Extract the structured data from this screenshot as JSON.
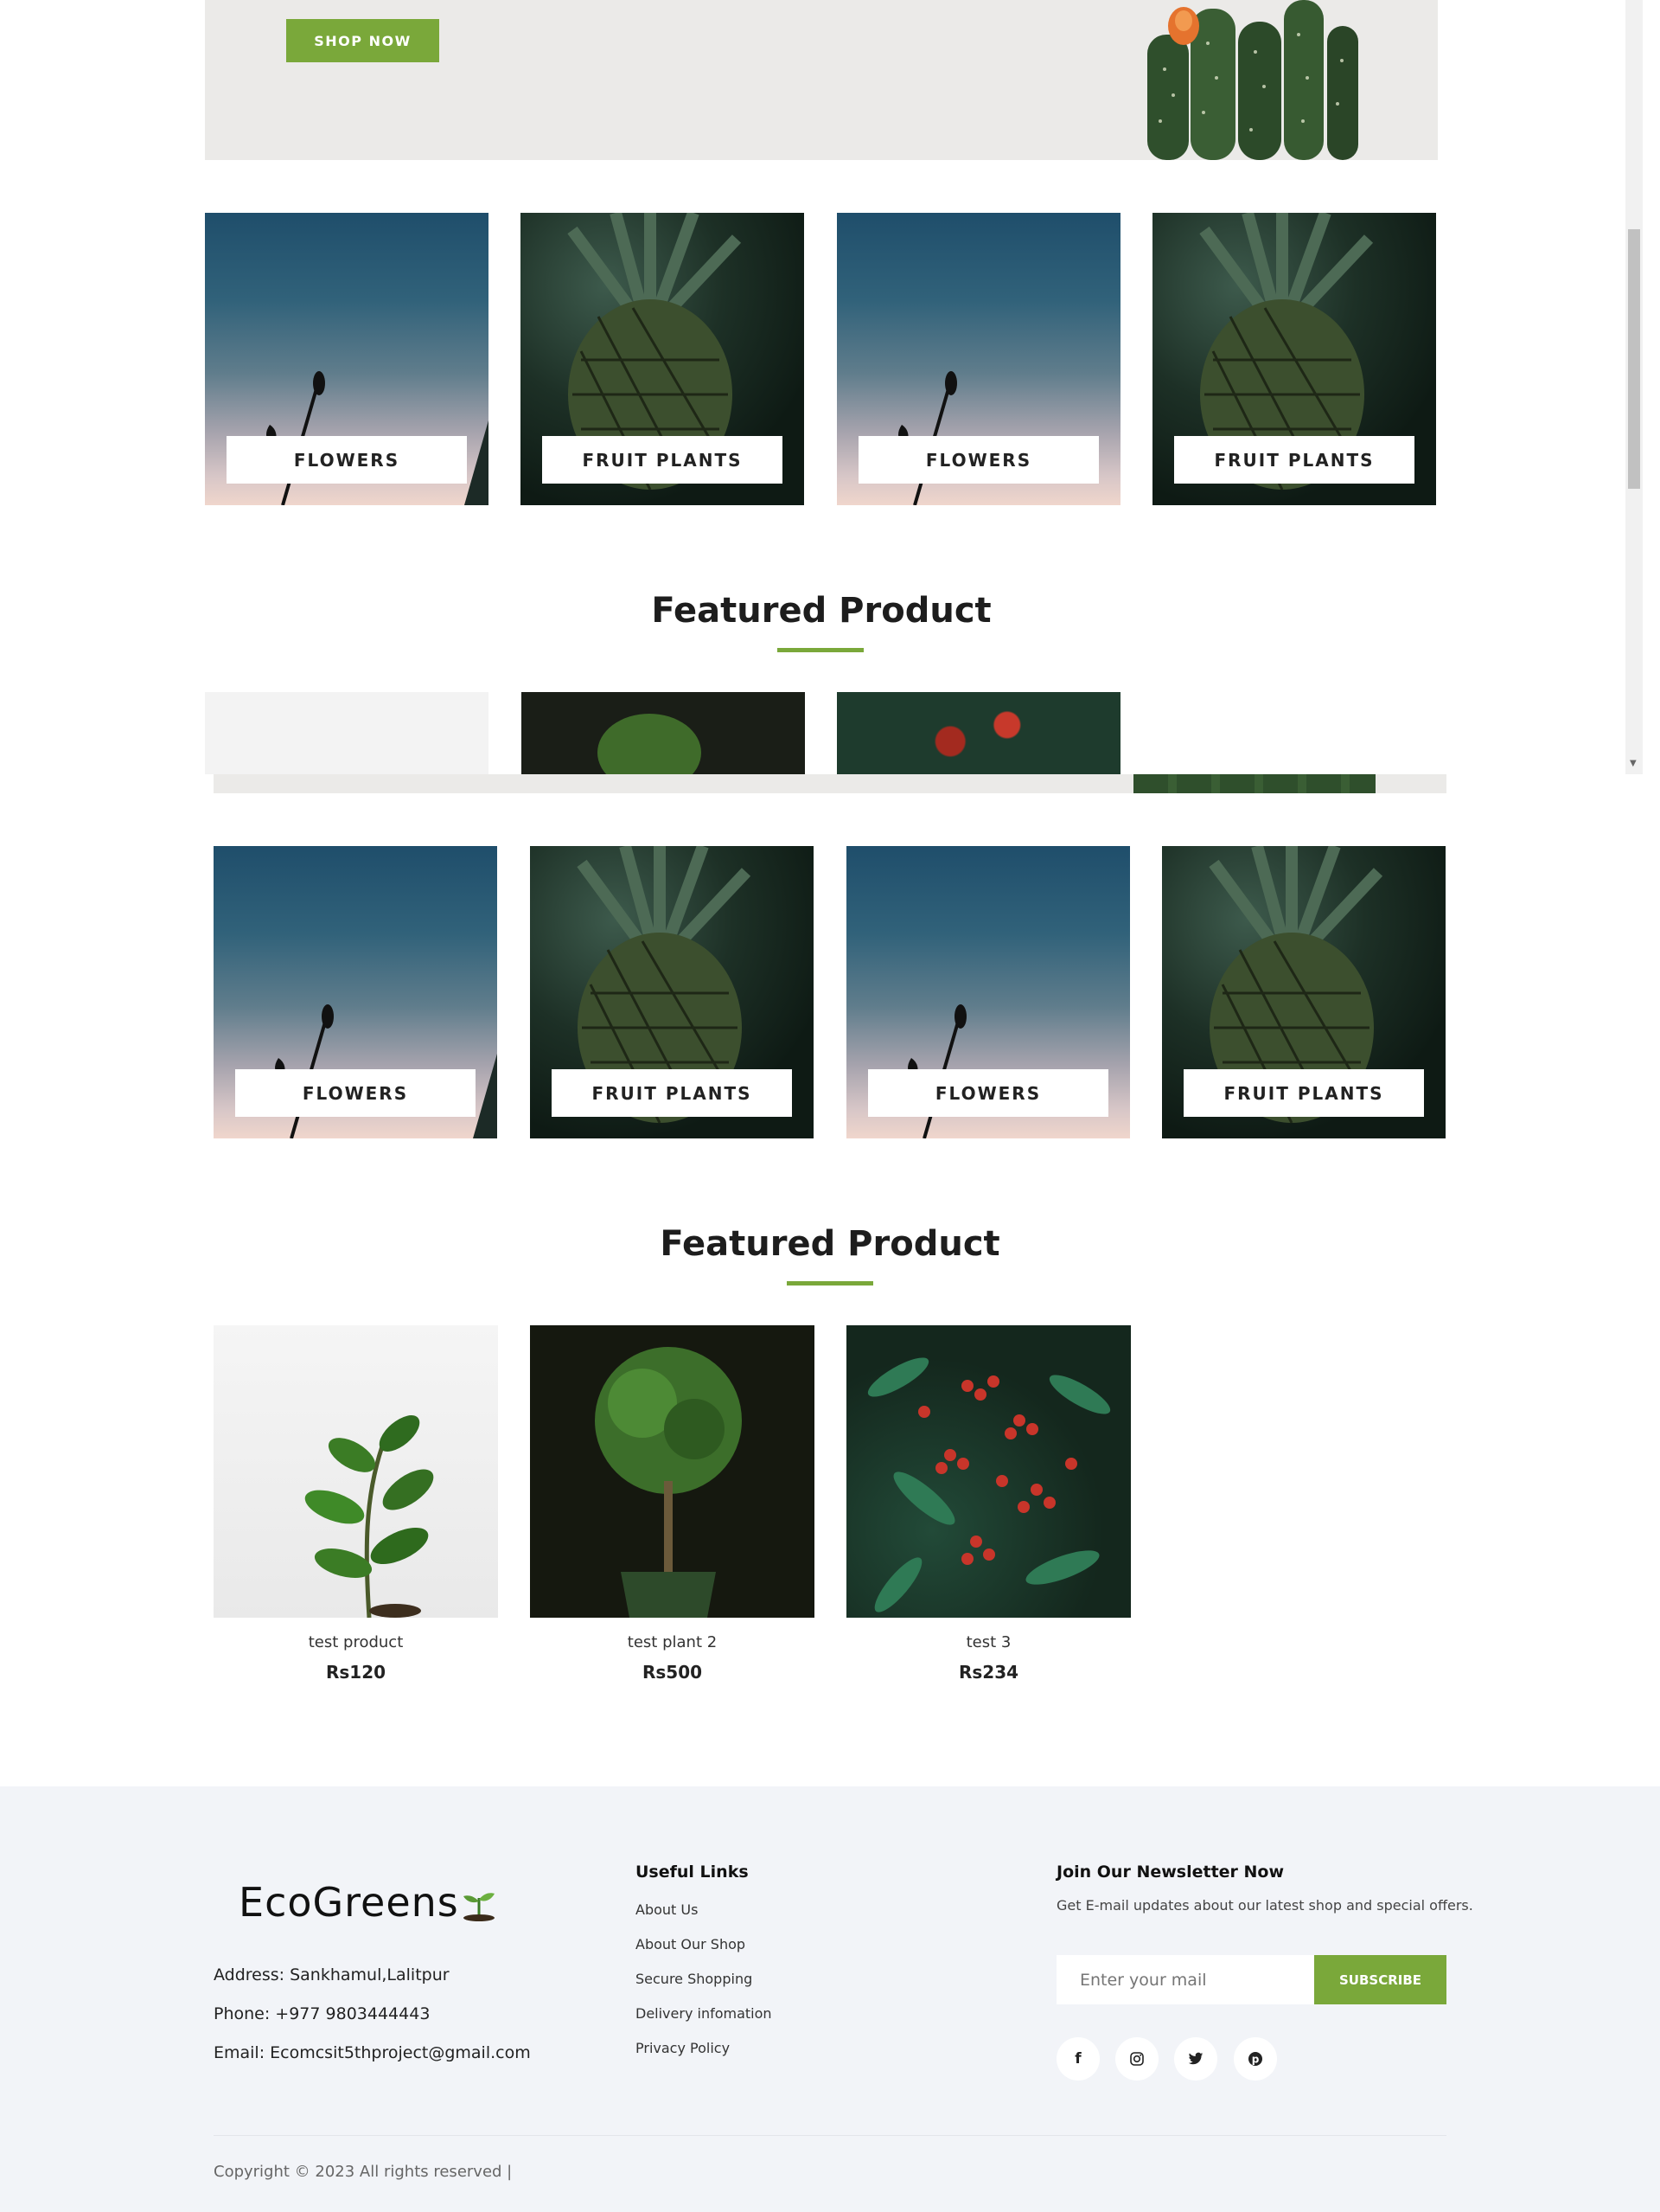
{
  "hero": {
    "button_label": "SHOP NOW"
  },
  "categories": [
    {
      "label": "FLOWERS"
    },
    {
      "label": "FRUIT PLANTS"
    },
    {
      "label": "FLOWERS"
    },
    {
      "label": "FRUIT PLANTS"
    }
  ],
  "featured": {
    "title": "Featured Product"
  },
  "products": [
    {
      "name": "test product",
      "price": "Rs120"
    },
    {
      "name": "test plant 2",
      "price": "Rs500"
    },
    {
      "name": "test 3",
      "price": "Rs234"
    }
  ],
  "footer": {
    "logo_text": "EcoGreens",
    "address": "Address: Sankhamul,Lalitpur",
    "phone": "Phone: +977 9803444443",
    "email": "Email: Ecomcsit5thproject@gmail.com",
    "useful_links_title": "Useful Links",
    "links": [
      "About Us",
      "About Our Shop",
      "Secure Shopping",
      "Delivery infomation",
      "Privacy Policy"
    ],
    "newsletter_title": "Join Our Newsletter Now",
    "newsletter_text": "Get E-mail updates about our latest shop and special offers.",
    "email_placeholder": "Enter your mail",
    "subscribe_label": "SUBSCRIBE",
    "social": [
      "facebook-icon",
      "instagram-icon",
      "twitter-icon",
      "pinterest-icon"
    ],
    "copyright": "Copyright © 2023 All rights reserved |"
  },
  "colors": {
    "accent": "#7aa83a",
    "footer_bg": "#f2f4f8",
    "hero_bg": "#ebeae8"
  }
}
